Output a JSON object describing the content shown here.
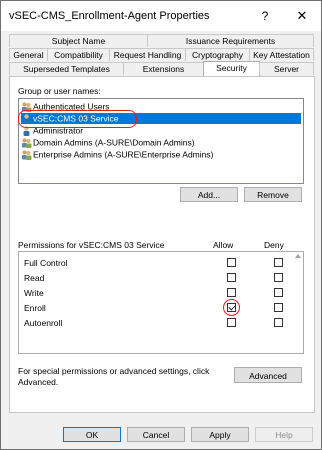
{
  "window": {
    "title": "vSEC-CMS_Enrollment-Agent Properties",
    "help": "?",
    "close": "✕"
  },
  "tabs": {
    "row1": [
      "Subject Name",
      "Issuance Requirements"
    ],
    "row2": [
      "General",
      "Compatibility",
      "Request Handling",
      "Cryptography",
      "Key Attestation"
    ],
    "row3": [
      "Superseded Templates",
      "Extensions",
      "Security",
      "Server"
    ],
    "active": "Security"
  },
  "security": {
    "group_label": "Group or user names:",
    "users": [
      {
        "name": "Authenticated Users",
        "icon": "group-users-icon",
        "selected": false
      },
      {
        "name": "vSEC:CMS 03 Service",
        "icon": "user-icon",
        "selected": true
      },
      {
        "name": "Administrator",
        "icon": "user-icon",
        "selected": false
      },
      {
        "name": "Domain Admins (A-SURE\\Domain Admins)",
        "icon": "group-users-icon",
        "selected": false
      },
      {
        "name": "Enterprise Admins (A-SURE\\Enterprise Admins)",
        "icon": "group-users-icon",
        "selected": false
      }
    ],
    "add_label": "Add...",
    "remove_label": "Remove",
    "permissions_label": "Permissions for vSEC:CMS 03 Service",
    "allow_header": "Allow",
    "deny_header": "Deny",
    "permissions": [
      {
        "name": "Full Control",
        "allow": false,
        "deny": false
      },
      {
        "name": "Read",
        "allow": false,
        "deny": false
      },
      {
        "name": "Write",
        "allow": false,
        "deny": false
      },
      {
        "name": "Enroll",
        "allow": true,
        "deny": false
      },
      {
        "name": "Autoenroll",
        "allow": false,
        "deny": false
      }
    ],
    "advanced_text_line1": "For special permissions or advanced settings, click",
    "advanced_text_line2": "Advanced.",
    "advanced_label": "Advanced"
  },
  "footer": {
    "ok": "OK",
    "cancel": "Cancel",
    "apply": "Apply",
    "help": "Help"
  },
  "colors": {
    "selection": "#0078d7",
    "highlight_ring": "#e02020"
  }
}
